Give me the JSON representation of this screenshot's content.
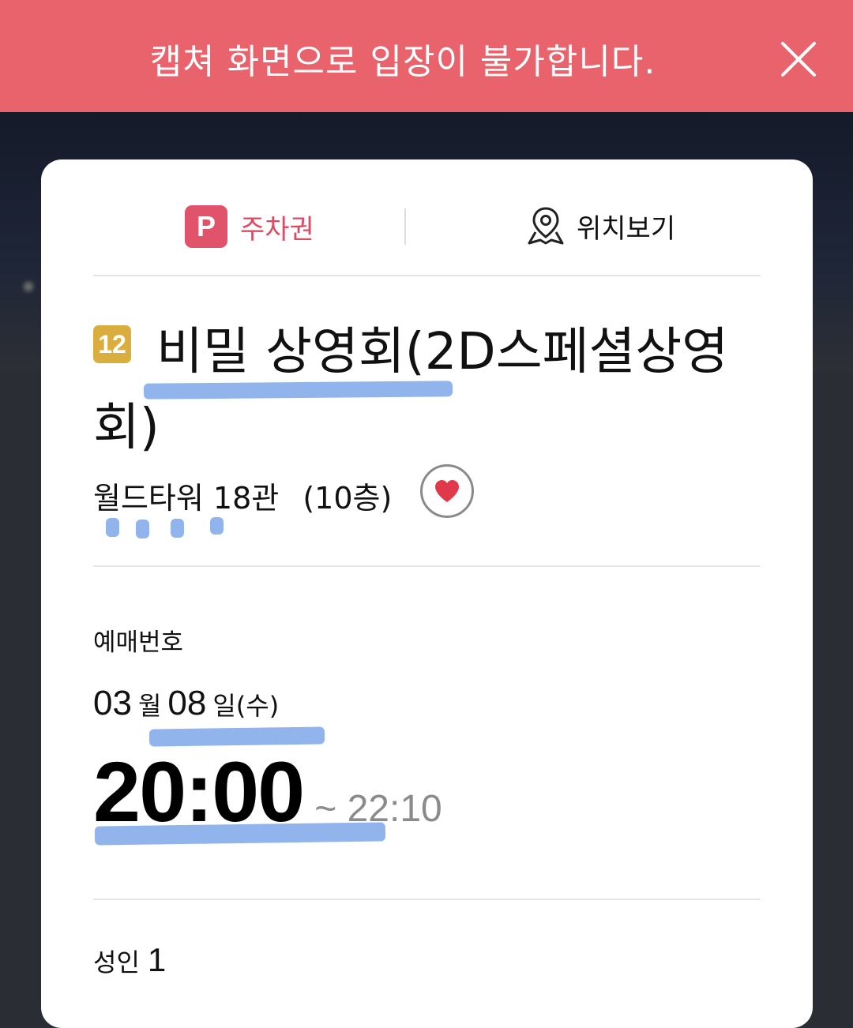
{
  "banner": {
    "message": "캡쳐 화면으로 입장이 불가합니다.",
    "close_icon": "close-icon"
  },
  "actions": {
    "parking_icon_letter": "P",
    "parking_label": "주차권",
    "location_label": "위치보기"
  },
  "movie": {
    "rating": "12",
    "title": "비밀 상영회(2D스페셜상영회)",
    "theater": "월드타워 18관",
    "floor": "(10층)"
  },
  "booking": {
    "number_label": "예매번호",
    "month": "03",
    "month_unit": "월",
    "day": "08",
    "day_unit": "일(수)",
    "start_time": "20:00",
    "end_time": "~ 22:10"
  },
  "audience": {
    "label": "성인",
    "count": "1"
  },
  "colors": {
    "banner": "#e8636c",
    "parking_accent": "#e0536a",
    "rating_badge": "#d9ae3e",
    "heart": "#e03a4a",
    "highlight_marks": "#8ab0ea"
  }
}
